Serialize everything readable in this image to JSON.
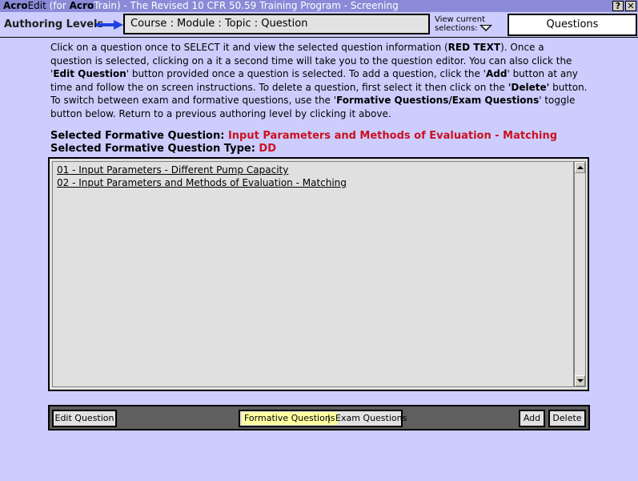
{
  "titlebar": {
    "app_bold": "Acro",
    "app_rest": "Edit",
    "for_open": " (for ",
    "product_bold": "Acro",
    "product_rest": "Train)",
    "program": " - The Revised 10 CFR 50.59 Training Program - Screening",
    "help_label": "?",
    "close_label": "✕"
  },
  "header": {
    "authoring_label": "Authoring Levels",
    "breadcrumb": "Course : Module : Topic : Question",
    "view_current_line1": "View current",
    "view_current_line2": "selections:",
    "level_box": "Questions",
    "arrow_color": "#1f3fe0"
  },
  "instructions": {
    "p1": "Click on a question once to SELECT it and view the selected question information (",
    "red_text": "RED TEXT",
    "p2": "). Once a question is selected, clicking on a it a second time will take you to the question editor. You can also click the '",
    "edit_question": "Edit Question",
    "p3": "' button provided once a question is selected. To add a question, click the '",
    "add": "Add",
    "p4": "' button at any time and follow the on screen instructions. To delete a question, first select it then click on the ",
    "delete": "'Delete'",
    "p5": " button. To switch between exam and formative questions, use the '",
    "toggle_name": "Formative Questions/Exam Questions",
    "p6": "' toggle button below. Return to a previous authoring level by clicking it above."
  },
  "selected": {
    "question_label": "Selected Formative Question: ",
    "question_value": "Input Parameters and Methods of Evaluation - Matching",
    "type_label": "Selected Formative Question Type: ",
    "type_value": "DD",
    "highlight_color": "#cc1020"
  },
  "questions_list": [
    "01 - Input Parameters - Different Pump Capacity",
    "02 - Input Parameters and Methods of Evaluation - Matching"
  ],
  "toolbar": {
    "edit_label": "Edit Question",
    "formative_label": "Formative Questions",
    "separator": "|",
    "exam_label": "Exam Questions",
    "add_label": "Add",
    "delete_label": "Delete"
  },
  "colors": {
    "background": "#cccdfd",
    "titlebar": "#8a8ad8",
    "toolbar": "#5f5f5f",
    "active_toggle": "#ffffa0"
  },
  "icons": {
    "help": "help-icon",
    "close": "close-icon",
    "pointer_arrow": "arrow-right-icon",
    "dropdown": "triangle-down-icon",
    "scroll_up": "scroll-up-icon",
    "scroll_down": "scroll-down-icon"
  }
}
